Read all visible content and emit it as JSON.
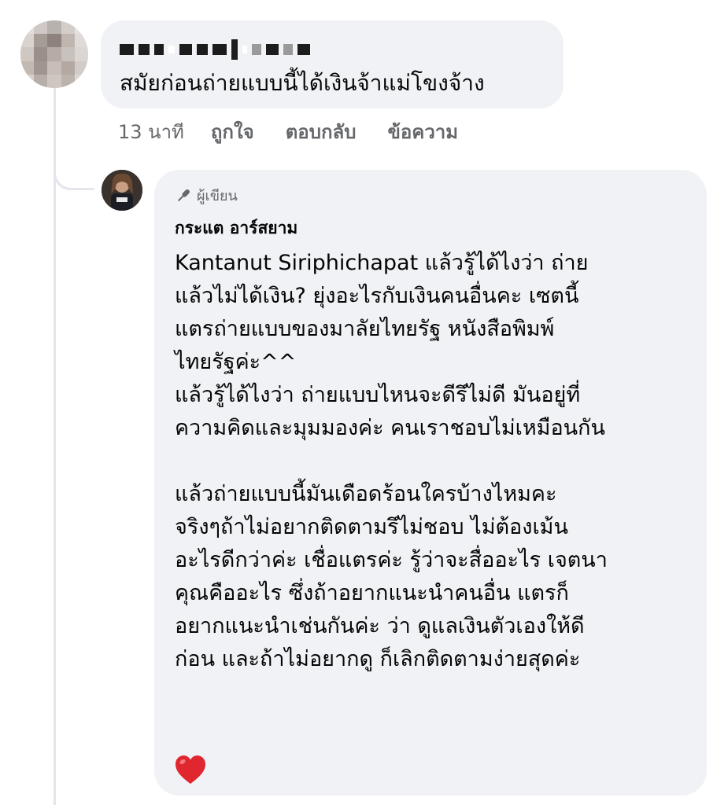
{
  "comment": {
    "text": "สมัยก่อนถ่ายแบบนี้ได้เงินจ้าแม่โขงจ้าง",
    "time": "13 นาที",
    "like_label": "ถูกใจ",
    "reply_label": "ตอบกลับ",
    "message_label": "ข้อความ"
  },
  "reply": {
    "badge": "ผู้เขียน",
    "author": "กระแต อาร์สยาม",
    "lines_p1": [
      "Kantanut Siriphichapat แล้วรู้ได้ไงว่า ถ่าย",
      "แล้วไม่ได้เงิน? ยุ่งอะไรกับเงินคนอื่นคะ เซตนี้",
      "แตรถ่ายแบบของมาลัยไทยรัฐ หนังสือพิมพ์",
      "ไทยรัฐค่ะ^^",
      "แล้วรู้ได้ไงว่า ถ่ายแบบไหนจะดีรึไม่ดี  มันอยู่ที่",
      "ความคิดและมุมมองค่ะ คนเราชอบไม่เหมือนกัน"
    ],
    "lines_p2": [
      "แล้วถ่ายแบบนี้มันเดือดร้อนใครบ้างไหมคะ",
      "จริงๆถ้าไม่อยากติดตามรึไม่ชอบ ไม่ต้องเม้น",
      "อะไรดีกว่าค่ะ เชื่อแตรค่ะ รู้ว่าจะสื่ออะไร เจตนา",
      "คุณคืออะไร ซึ่งถ้าอยากแนะนำคนอื่น แตรก็",
      "อยากแนะนำเช่นกันค่ะ ว่า ดูแลเงินตัวเองให้ดี",
      "ก่อน และถ้าไม่อยากดู ก็เลิกติดตามง่ายสุดค่ะ"
    ]
  },
  "icons": {
    "badge_icon": "microphone-icon",
    "emoji": "heart-emoji-icon"
  },
  "colors": {
    "bubble": "#f0f2f5",
    "secondary_text": "#65676b",
    "heart": "#e0262f"
  }
}
